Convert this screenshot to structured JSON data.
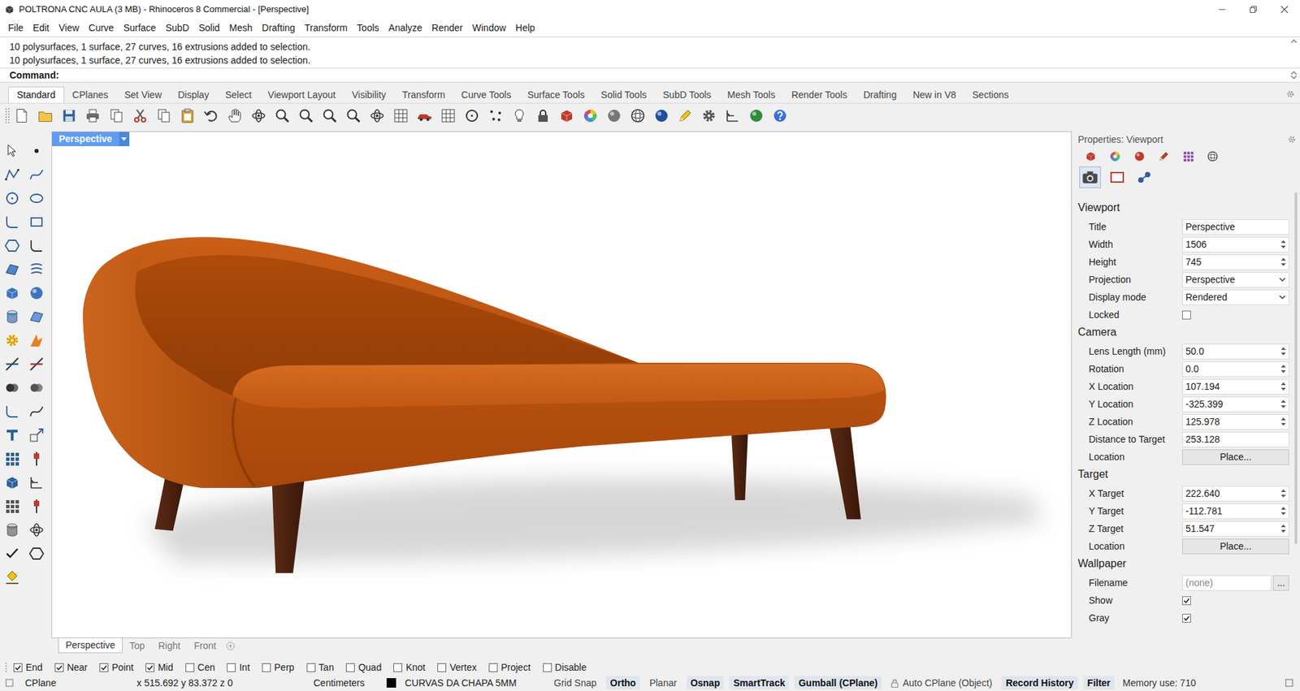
{
  "window": {
    "title": "POLTRONA CNC AULA (3 MB) - Rhinoceros 8 Commercial - [Perspective]"
  },
  "menu": [
    "File",
    "Edit",
    "View",
    "Curve",
    "Surface",
    "SubD",
    "Solid",
    "Mesh",
    "Drafting",
    "Transform",
    "Tools",
    "Analyze",
    "Render",
    "Window",
    "Help"
  ],
  "command_history": [
    "10 polysurfaces, 1 surface, 27 curves, 16 extrusions added to selection.",
    "10 polysurfaces, 1 surface, 27 curves, 16 extrusions added to selection."
  ],
  "command_prompt": "Command:",
  "toolbar_tabs": [
    {
      "label": "Standard",
      "selected": true
    },
    {
      "label": "CPlanes",
      "selected": false
    },
    {
      "label": "Set View",
      "selected": false
    },
    {
      "label": "Display",
      "selected": false
    },
    {
      "label": "Select",
      "selected": false
    },
    {
      "label": "Viewport Layout",
      "selected": false
    },
    {
      "label": "Visibility",
      "selected": false
    },
    {
      "label": "Transform",
      "selected": false
    },
    {
      "label": "Curve Tools",
      "selected": false
    },
    {
      "label": "Surface Tools",
      "selected": false
    },
    {
      "label": "Solid Tools",
      "selected": false
    },
    {
      "label": "SubD Tools",
      "selected": false
    },
    {
      "label": "Mesh Tools",
      "selected": false
    },
    {
      "label": "Render Tools",
      "selected": false
    },
    {
      "label": "Drafting",
      "selected": false
    },
    {
      "label": "New in V8",
      "selected": false
    },
    {
      "label": "Sections",
      "selected": false
    }
  ],
  "viewport": {
    "title": "Perspective",
    "tabs": [
      {
        "label": "Perspective",
        "selected": true
      },
      {
        "label": "Top",
        "selected": false
      },
      {
        "label": "Right",
        "selected": false
      },
      {
        "label": "Front",
        "selected": false
      }
    ]
  },
  "properties": {
    "header": "Properties: Viewport",
    "sections": [
      {
        "title": "Viewport",
        "rows": [
          {
            "label": "Title",
            "value": "Perspective",
            "kind": "text"
          },
          {
            "label": "Width",
            "value": "1506",
            "kind": "spin"
          },
          {
            "label": "Height",
            "value": "745",
            "kind": "spin"
          },
          {
            "label": "Projection",
            "value": "Perspective",
            "kind": "select"
          },
          {
            "label": "Display mode",
            "value": "Rendered",
            "kind": "select"
          },
          {
            "label": "Locked",
            "kind": "checkbox",
            "checked": false
          }
        ]
      },
      {
        "title": "Camera",
        "rows": [
          {
            "label": "Lens Length (mm)",
            "value": "50.0",
            "kind": "spin"
          },
          {
            "label": "Rotation",
            "value": "0.0",
            "kind": "spin"
          },
          {
            "label": "X Location",
            "value": "107.194",
            "kind": "spin"
          },
          {
            "label": "Y Location",
            "value": "-325.399",
            "kind": "spin"
          },
          {
            "label": "Z Location",
            "value": "125.978",
            "kind": "spin"
          },
          {
            "label": "Distance to Target",
            "value": "253.128",
            "kind": "text"
          },
          {
            "label": "Location",
            "value": "Place...",
            "kind": "button"
          }
        ]
      },
      {
        "title": "Target",
        "rows": [
          {
            "label": "X Target",
            "value": "222.640",
            "kind": "spin"
          },
          {
            "label": "Y Target",
            "value": "-112.781",
            "kind": "spin"
          },
          {
            "label": "Z Target",
            "value": "51.547",
            "kind": "spin"
          },
          {
            "label": "Location",
            "value": "Place...",
            "kind": "button"
          }
        ]
      },
      {
        "title": "Wallpaper",
        "rows": [
          {
            "label": "Filename",
            "value": "(none)",
            "kind": "file",
            "button": "..."
          },
          {
            "label": "Show",
            "kind": "checkbox",
            "checked": true
          },
          {
            "label": "Gray",
            "kind": "checkbox",
            "checked": true
          }
        ]
      }
    ]
  },
  "osnaps": [
    {
      "label": "End",
      "checked": true
    },
    {
      "label": "Near",
      "checked": true
    },
    {
      "label": "Point",
      "checked": true
    },
    {
      "label": "Mid",
      "checked": true
    },
    {
      "label": "Cen",
      "checked": false
    },
    {
      "label": "Int",
      "checked": false
    },
    {
      "label": "Perp",
      "checked": false
    },
    {
      "label": "Tan",
      "checked": false
    },
    {
      "label": "Quad",
      "checked": false
    },
    {
      "label": "Knot",
      "checked": false
    },
    {
      "label": "Vertex",
      "checked": false
    },
    {
      "label": "Project",
      "checked": false
    },
    {
      "label": "Disable",
      "checked": false
    }
  ],
  "status_bar": {
    "cplane": "CPlane",
    "coordinates": "x 515.692 y 83.372 z 0",
    "units": "Centimeters",
    "layer": {
      "name": "CURVAS DA CHAPA 5MM",
      "color": "#000000"
    },
    "toggles": [
      {
        "label": "Grid Snap",
        "active": false
      },
      {
        "label": "Ortho",
        "active": true
      },
      {
        "label": "Planar",
        "active": false
      },
      {
        "label": "Osnap",
        "active": true
      },
      {
        "label": "SmartTrack",
        "active": true
      },
      {
        "label": "Gumball (CPlane)",
        "active": true
      },
      {
        "label": "Auto CPlane (Object)",
        "active": false,
        "locked": true
      },
      {
        "label": "Record History",
        "active": true
      },
      {
        "label": "Filter",
        "active": true
      }
    ],
    "memory": "Memory use: 710"
  }
}
